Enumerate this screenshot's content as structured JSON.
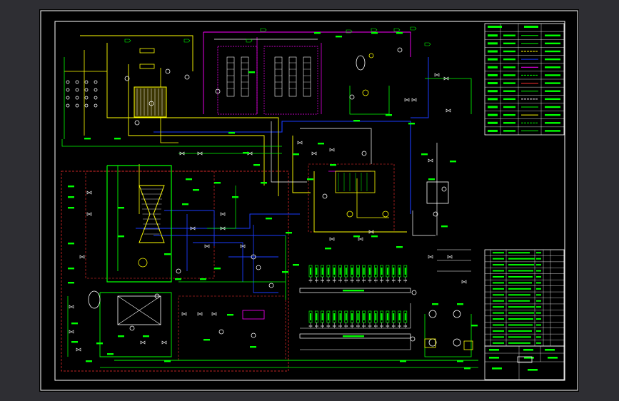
{
  "colors": {
    "background": "#2e2e33",
    "sheet": "#000000",
    "border": "#ffffff",
    "green": "#00ff00",
    "yellow": "#ffff00",
    "blue": "#1a3cff",
    "magenta": "#ff00ff",
    "red": "#ff3030",
    "white": "#ffffff",
    "cyan": "#00e0ff"
  },
  "drawing": {
    "type": "P&ID process flow diagram (CAD)",
    "legend_rows": 13,
    "bom_rows": 16
  }
}
